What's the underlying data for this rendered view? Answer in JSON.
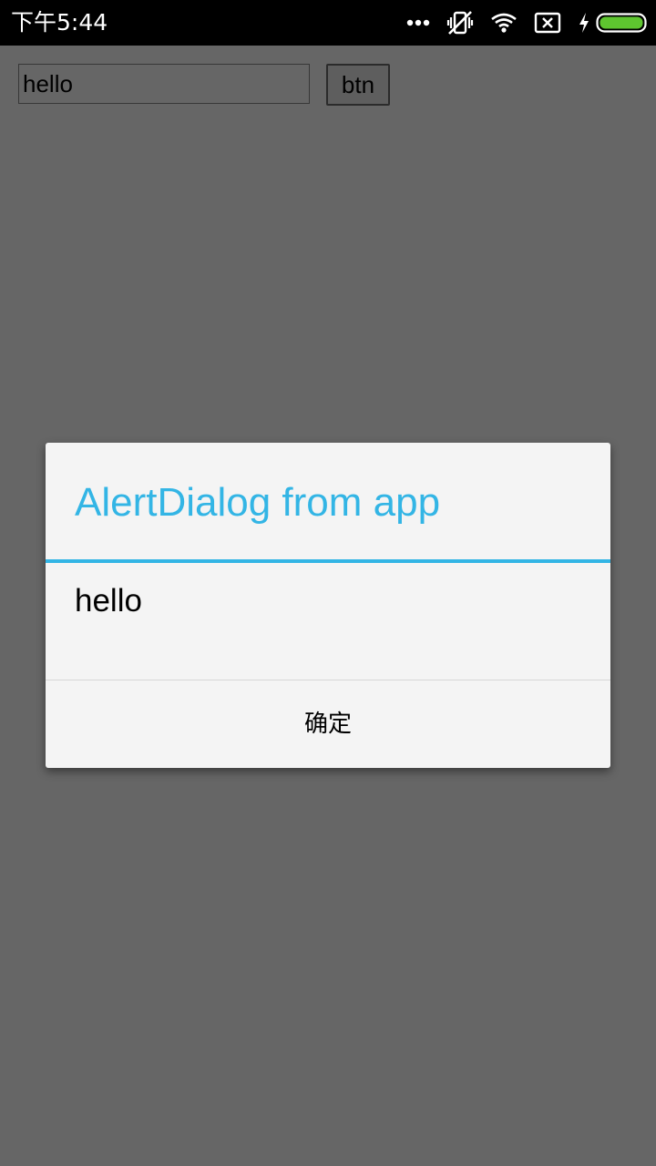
{
  "status_bar": {
    "time": "下午5:44",
    "icons": [
      "more-dots-icon",
      "vibrate-off-icon",
      "wifi-icon",
      "no-sim-icon",
      "charging-bolt-icon",
      "battery-icon"
    ],
    "battery_color": "#5ec62f"
  },
  "app": {
    "input_value": "hello",
    "button_label": "btn"
  },
  "dialog": {
    "title": "AlertDialog from app",
    "message": "hello",
    "positive_button": "确定",
    "accent_color": "#33b5e5"
  }
}
